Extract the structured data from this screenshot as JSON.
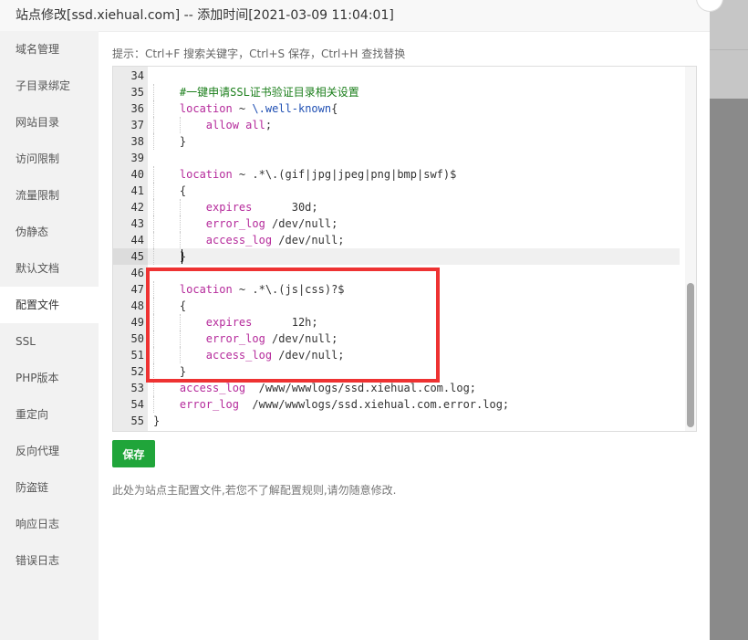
{
  "dialog": {
    "title": "站点修改[ssd.xiehual.com] -- 添加时间[2021-03-09 11:04:01]"
  },
  "sidebar": {
    "items": [
      {
        "label": "域名管理"
      },
      {
        "label": "子目录绑定"
      },
      {
        "label": "网站目录"
      },
      {
        "label": "访问限制"
      },
      {
        "label": "流量限制"
      },
      {
        "label": "伪静态"
      },
      {
        "label": "默认文档"
      },
      {
        "label": "配置文件",
        "active": true
      },
      {
        "label": "SSL"
      },
      {
        "label": "PHP版本"
      },
      {
        "label": "重定向"
      },
      {
        "label": "反向代理"
      },
      {
        "label": "防盗链"
      },
      {
        "label": "响应日志"
      },
      {
        "label": "错误日志"
      }
    ]
  },
  "main": {
    "tip": "提示：Ctrl+F 搜索关键字，Ctrl+S 保存，Ctrl+H 查找替换",
    "save_label": "保存",
    "note": "此处为站点主配置文件,若您不了解配置规则,请勿随意修改."
  },
  "editor": {
    "active_line": "45",
    "lines": [
      {
        "n": "34",
        "t": ""
      },
      {
        "n": "35",
        "t": "    #一键申请SSL证书验证目录相关设置"
      },
      {
        "n": "36",
        "t": "    location ~ \\.well-known{"
      },
      {
        "n": "37",
        "t": "        allow all;"
      },
      {
        "n": "38",
        "t": "    }"
      },
      {
        "n": "39",
        "t": ""
      },
      {
        "n": "40",
        "t": "    location ~ .*\\.(gif|jpg|jpeg|png|bmp|swf)$"
      },
      {
        "n": "41",
        "t": "    {"
      },
      {
        "n": "42",
        "t": "        expires      30d;"
      },
      {
        "n": "43",
        "t": "        error_log /dev/null;"
      },
      {
        "n": "44",
        "t": "        access_log /dev/null;"
      },
      {
        "n": "45",
        "t": "    }"
      },
      {
        "n": "46",
        "t": ""
      },
      {
        "n": "47",
        "t": "    location ~ .*\\.(js|css)?$"
      },
      {
        "n": "48",
        "t": "    {"
      },
      {
        "n": "49",
        "t": "        expires      12h;"
      },
      {
        "n": "50",
        "t": "        error_log /dev/null;"
      },
      {
        "n": "51",
        "t": "        access_log /dev/null;"
      },
      {
        "n": "52",
        "t": "    }"
      },
      {
        "n": "53",
        "t": "    access_log  /www/wwwlogs/ssd.xiehual.com.log;"
      },
      {
        "n": "54",
        "t": "    error_log  /www/wwwlogs/ssd.xiehual.com.error.log;"
      },
      {
        "n": "55",
        "t": "}"
      }
    ]
  },
  "colors": {
    "accent": "#20a53a",
    "highlight": "#ee3232",
    "keyword": "#b52a9b",
    "comment": "#1a7e1a"
  }
}
